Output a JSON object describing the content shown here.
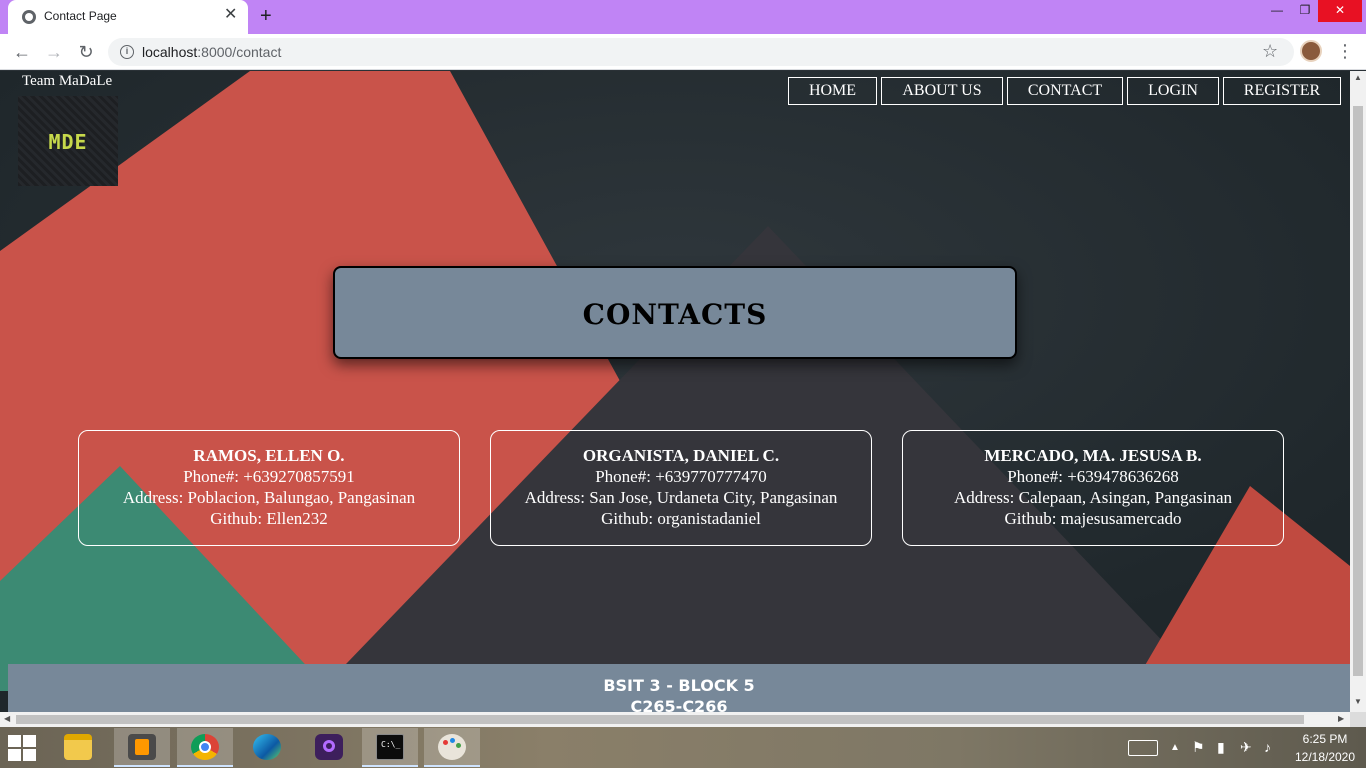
{
  "browser": {
    "tab_title": "Contact Page",
    "tab_close": "✕",
    "new_tab": "+",
    "url_host": "localhost",
    "url_path": ":8000/contact",
    "window_controls": {
      "minimize": "—",
      "maximize": "❐",
      "close": "✕"
    }
  },
  "site": {
    "brand": "Team MaDaLe",
    "logo_text": "MDE",
    "nav": [
      "HOME",
      "ABOUT US",
      "CONTACT",
      "LOGIN",
      "REGISTER"
    ],
    "heading": "CONTACTS",
    "contacts": [
      {
        "name": "RAMOS, ELLEN O.",
        "phone": "Phone#: +639270857591",
        "address": "Address: Poblacion, Balungao, Pangasinan",
        "github": "Github: Ellen232"
      },
      {
        "name": "ORGANISTA, DANIEL C.",
        "phone": "Phone#: +639770777470",
        "address": "Address: San Jose, Urdaneta City, Pangasinan",
        "github": "Github: organistadaniel"
      },
      {
        "name": "MERCADO, MA. JESUSA B.",
        "phone": "Phone#: +639478636268",
        "address": "Address: Calepaan, Asingan, Pangasinan",
        "github": "Github: majesusamercado"
      }
    ],
    "footer_line1": "BSIT 3 - BLOCK 5",
    "footer_line2": "C265-C266"
  },
  "taskbar": {
    "time": "6:25 PM",
    "date": "12/18/2020",
    "apps": [
      "file-explorer",
      "sublime-text",
      "chrome",
      "edge",
      "app-purple",
      "command-prompt",
      "paint"
    ]
  },
  "colors": {
    "titlebar": "#c084f5",
    "box": "#778899",
    "bg_dark": "#283136",
    "red": "#c9534a",
    "teal": "#3c8a73"
  }
}
